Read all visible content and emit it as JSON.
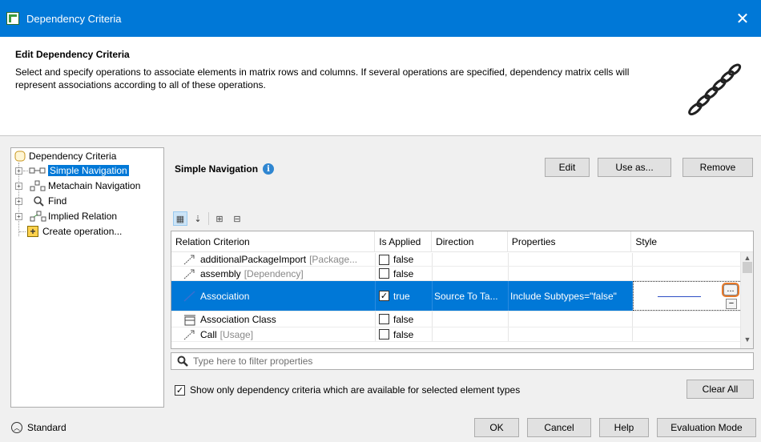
{
  "window": {
    "title": "Dependency Criteria",
    "close_glyph": "✕"
  },
  "header": {
    "title": "Edit Dependency Criteria",
    "description": "Select and specify operations to associate elements in matrix rows and columns. If several operations are specified, dependency matrix cells will represent associations according to all of these operations."
  },
  "tree": {
    "root": "Dependency Criteria",
    "items": [
      {
        "label": "Simple Navigation",
        "icon": "simple-navigation-icon"
      },
      {
        "label": "Metachain Navigation",
        "icon": "metachain-icon"
      },
      {
        "label": "Find",
        "icon": "find-icon"
      },
      {
        "label": "Implied Relation",
        "icon": "implied-relation-icon"
      },
      {
        "label": "Create operation...",
        "icon": "plus-icon"
      }
    ]
  },
  "panel": {
    "title": "Simple Navigation",
    "edit_label": "Edit",
    "use_as_label": "Use as...",
    "remove_label": "Remove"
  },
  "table": {
    "columns": [
      "Relation Criterion",
      "Is Applied",
      "Direction",
      "Properties",
      "Style"
    ],
    "rows": [
      {
        "name": "additionalPackageImport",
        "type": "[Package...",
        "applied": "false",
        "direction": "",
        "properties": "",
        "selected": false
      },
      {
        "name": "assembly",
        "type": "[Dependency]",
        "applied": "false",
        "direction": "",
        "properties": "",
        "selected": false
      },
      {
        "name": "Association",
        "type": "",
        "applied": "true",
        "direction": "Source To Ta...",
        "properties": "Include Subtypes=\"false\"",
        "selected": true
      },
      {
        "name": "Association Class",
        "type": "",
        "applied": "false",
        "direction": "",
        "properties": "",
        "selected": false
      },
      {
        "name": "Call",
        "type": "[Usage]",
        "applied": "false",
        "direction": "",
        "properties": "",
        "selected": false
      }
    ],
    "style_button_label": "...",
    "style_remove_glyph": "−"
  },
  "filter": {
    "placeholder": "Type here to filter properties"
  },
  "show_only": {
    "label": "Show only dependency criteria which are available for selected element types",
    "checked": true
  },
  "clear_all_label": "Clear All",
  "footer": {
    "mode_label": "Standard",
    "ok_label": "OK",
    "cancel_label": "Cancel",
    "help_label": "Help",
    "evaluation_label": "Evaluation Mode"
  },
  "colors": {
    "accent": "#0078d7",
    "highlight_ring": "#e8792a"
  }
}
